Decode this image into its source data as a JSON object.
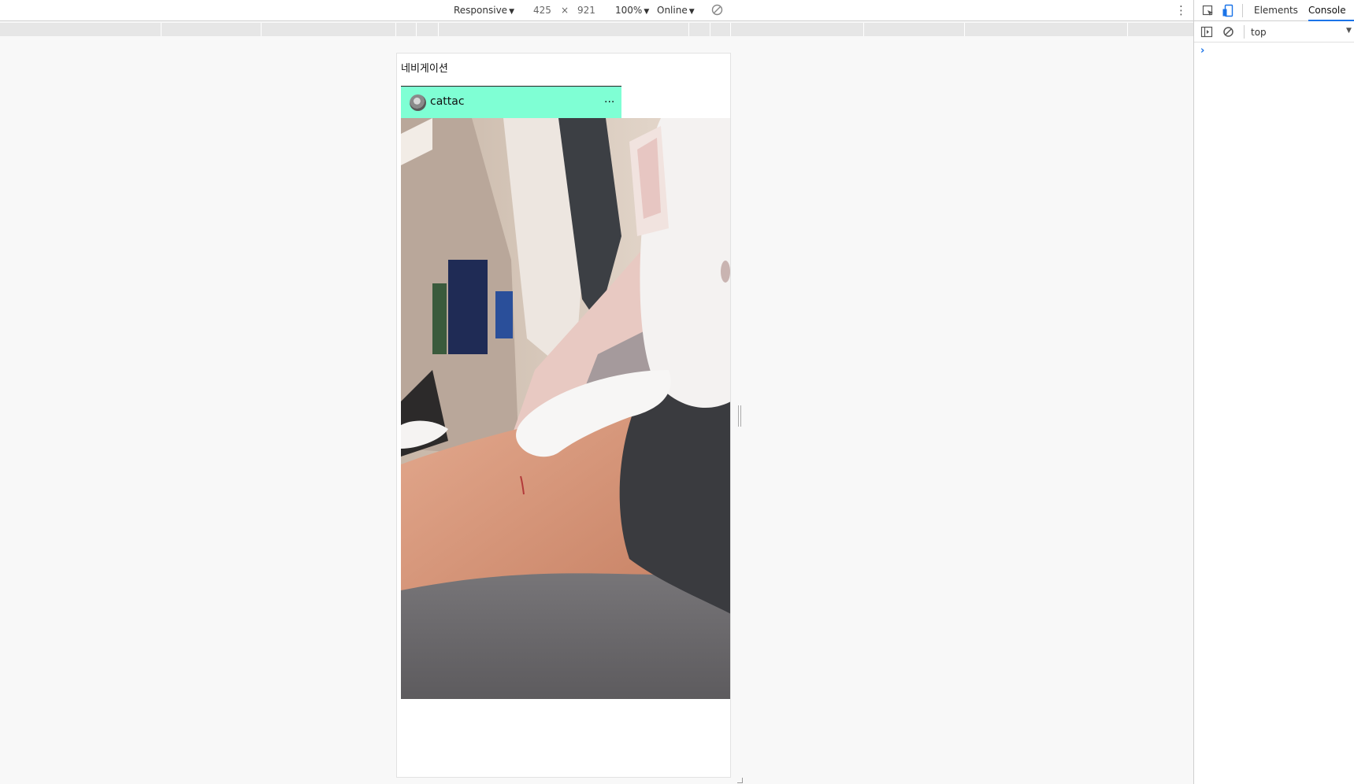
{
  "device_toolbar": {
    "device": "Responsive",
    "width": "425",
    "times": "×",
    "height": "921",
    "zoom": "100%",
    "throttling": "Online",
    "more_icon": "more-vert-icon",
    "rotate_icon": "rotate-icon"
  },
  "page": {
    "nav_text": "네비게이션",
    "post": {
      "username": "cattac",
      "more": "...",
      "avatar_icon": "cat-avatar"
    }
  },
  "devtools": {
    "tabs": [
      "Elements",
      "Console"
    ],
    "active_tab": "Console",
    "context": "top",
    "prompt": "›",
    "accent_color": "#1a73e8"
  },
  "colors": {
    "post_header_bg": "#7fffd4"
  }
}
